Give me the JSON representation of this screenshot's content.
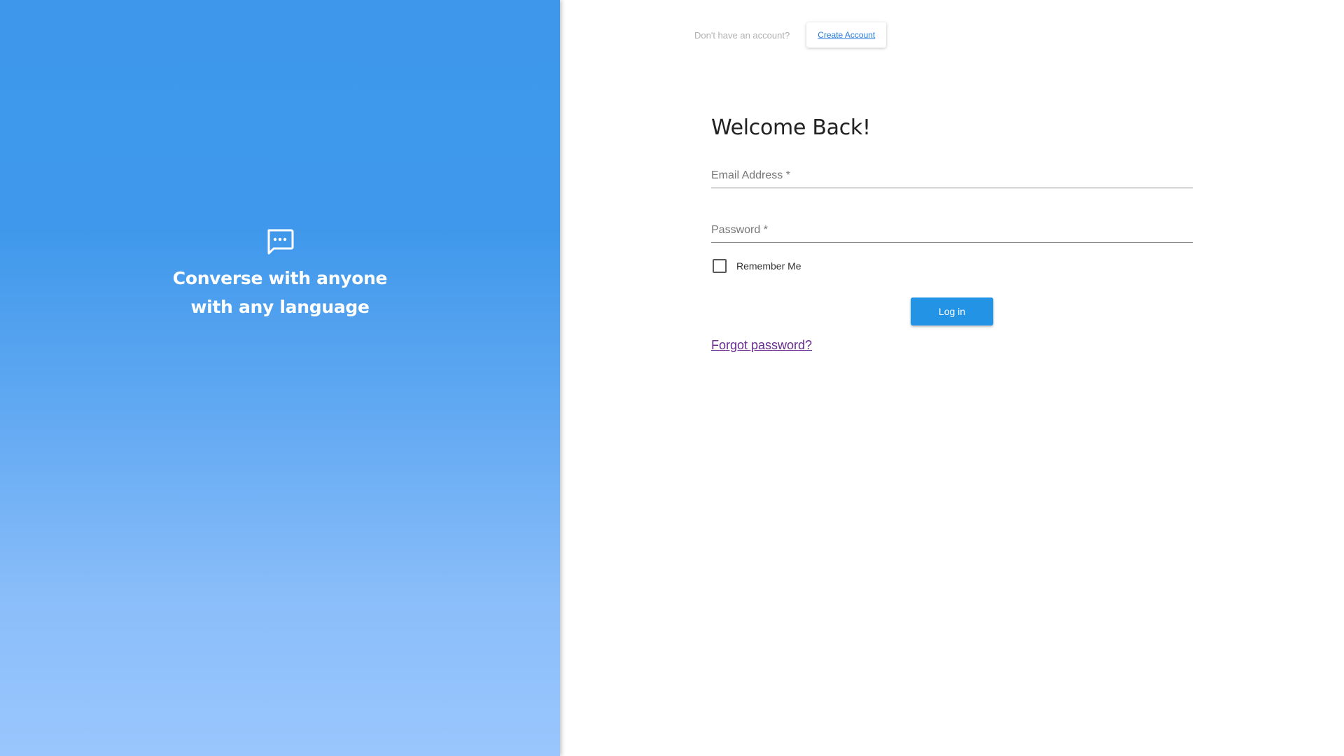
{
  "hero": {
    "icon": "chat-bubble-icon",
    "line1": "Converse with anyone",
    "line2": "with any language",
    "gradient_top": "#3e97eb",
    "gradient_bottom": "#9ac6fd"
  },
  "topbar": {
    "prompt": "Don't have an account?",
    "create_account_label": "Create Account"
  },
  "form": {
    "title": "Welcome Back!",
    "email_label": "Email Address *",
    "email_value": "",
    "password_label": "Password *",
    "password_value": "",
    "remember_label": "Remember Me",
    "remember_checked": false,
    "login_label": "Log in",
    "forgot_label": "Forgot password?"
  },
  "colors": {
    "primary": "#2393e6",
    "link": "#2a7fe0",
    "visited_link": "#6a2c91"
  }
}
